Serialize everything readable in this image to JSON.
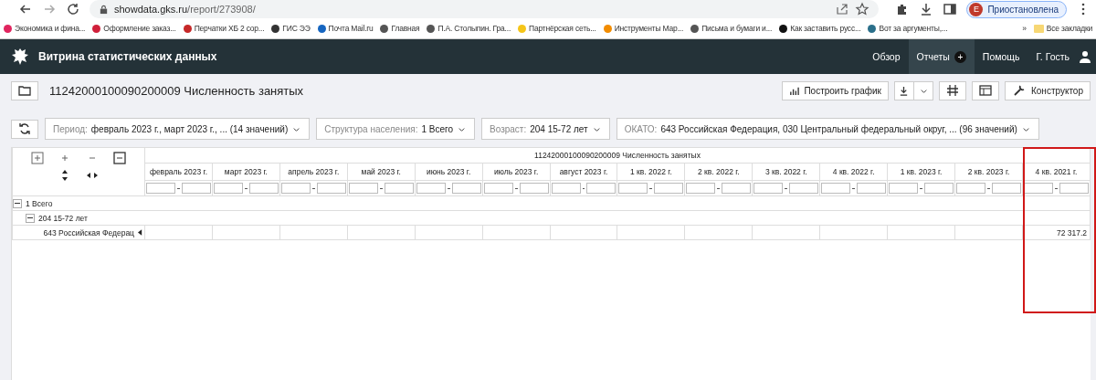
{
  "browser": {
    "url_host": "showdata.gks.ru",
    "url_path": "/report/273908/",
    "profile_initial": "Е",
    "profile_status": "Приостановлена",
    "bookmarks": [
      {
        "label": "Экономика и фина...",
        "color": "#e0245e"
      },
      {
        "label": "Оформление заказ...",
        "color": "#d0203a"
      },
      {
        "label": "Перчатки ХБ 2 сор...",
        "color": "#c62828"
      },
      {
        "label": "ГИС ЭЭ",
        "color": "#333333"
      },
      {
        "label": "Почта Mail.ru",
        "color": "#1565c0"
      },
      {
        "label": "Главная",
        "color": "#555555"
      },
      {
        "label": "П.А. Столыпин. Гра...",
        "color": "#555555"
      },
      {
        "label": "Партнёрская сеть...",
        "color": "#f5c518"
      },
      {
        "label": "Инструменты Мар...",
        "color": "#f28c00"
      },
      {
        "label": "Письма и бумаги и...",
        "color": "#555555"
      },
      {
        "label": "Как заставить русс...",
        "color": "#111111"
      },
      {
        "label": "Вот за аргументы,...",
        "color": "#2a6f8a"
      }
    ],
    "more": "»",
    "all_bookmarks": "Все закладки"
  },
  "header": {
    "title": "Витрина статистических данных",
    "nav": [
      {
        "label": "Обзор",
        "selected": false
      },
      {
        "label": "Отчеты",
        "selected": true,
        "badge": "+"
      },
      {
        "label": "Помощь",
        "selected": false
      }
    ],
    "user": "Г. Гость"
  },
  "report": {
    "title": "11242000100090200009 Численность занятых",
    "chart_button": "Построить график",
    "constructor_button": "Конструктор"
  },
  "filters": [
    {
      "label": "Период:",
      "value": "февраль 2023 г., март 2023 г., ... (14 значений)"
    },
    {
      "label": "Структура населения:",
      "value": "1 Всего"
    },
    {
      "label": "Возраст:",
      "value": "204 15-72 лет"
    },
    {
      "label": "ОКАТО:",
      "value": "643 Российская Федерация, 030 Центральный федеральный округ, ... (96 значений)"
    }
  ],
  "table": {
    "group_title": "11242000100090200009 Численность занятых",
    "columns": [
      {
        "label": "февраль 2023 г.",
        "highlighted": false
      },
      {
        "label": "март 2023 г.",
        "highlighted": false
      },
      {
        "label": "апрель 2023 г.",
        "highlighted": false
      },
      {
        "label": "май 2023 г.",
        "highlighted": false
      },
      {
        "label": "июнь 2023 г.",
        "highlighted": false
      },
      {
        "label": "июль 2023 г.",
        "highlighted": false
      },
      {
        "label": "август 2023 г.",
        "highlighted": false
      },
      {
        "label": "1 кв. 2022 г.",
        "highlighted": false
      },
      {
        "label": "2 кв. 2022 г.",
        "highlighted": false
      },
      {
        "label": "3 кв. 2022 г.",
        "highlighted": false
      },
      {
        "label": "4 кв. 2022 г.",
        "highlighted": false
      },
      {
        "label": "1 кв. 2023 г.",
        "highlighted": false
      },
      {
        "label": "2 кв. 2023 г.",
        "highlighted": false
      },
      {
        "label": "4 кв. 2021 г.",
        "highlighted": true
      }
    ],
    "rows": [
      {
        "label": "1 Всего",
        "expanded": true,
        "children": [
          {
            "label": "204 15-72 лет",
            "expanded": true,
            "children": [
              {
                "label": "643 Российская Федерац",
                "cells": [
                  null,
                  null,
                  null,
                  null,
                  null,
                  null,
                  null,
                  null,
                  null,
                  null,
                  null,
                  null,
                  null,
                  "72 317.2"
                ]
              }
            ]
          }
        ]
      }
    ]
  }
}
